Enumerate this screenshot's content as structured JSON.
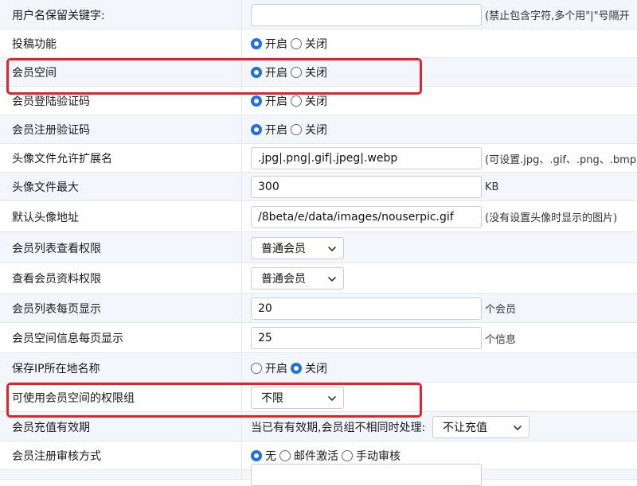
{
  "rows": [
    {
      "label": "用户名保留关键字:",
      "value": "",
      "hint": "(禁止包含字符,多个用\"|\"号隔开"
    },
    {
      "label": "投稿功能",
      "options": [
        "开启",
        "关闭"
      ],
      "selected": "开启"
    },
    {
      "label": "会员空间",
      "options": [
        "开启",
        "关闭"
      ],
      "selected": "开启"
    },
    {
      "label": "会员登陆验证码",
      "options": [
        "开启",
        "关闭"
      ],
      "selected": "开启"
    },
    {
      "label": "会员注册验证码",
      "options": [
        "开启",
        "关闭"
      ],
      "selected": "开启"
    },
    {
      "label": "头像文件允许扩展名",
      "value": ".jpg|.png|.gif|.jpeg|.webp",
      "hint": "(可设置.jpg、.gif、.png、.bmp"
    },
    {
      "label": "头像文件最大",
      "value": "300",
      "hint": "KB"
    },
    {
      "label": "默认头像地址",
      "value": "/8beta/e/data/images/nouserpic.gif",
      "hint": "(没有设置头像时显示的图片)"
    },
    {
      "label": "会员列表查看权限",
      "select": "普通会员"
    },
    {
      "label": "查看会员资料权限",
      "select": "普通会员"
    },
    {
      "label": "会员列表每页显示",
      "value": "20",
      "hint": "个会员"
    },
    {
      "label": "会员空间信息每页显示",
      "value": "25",
      "hint": "个信息"
    },
    {
      "label": "保存IP所在地名称",
      "options": [
        "开启",
        "关闭"
      ],
      "selected": "关闭"
    },
    {
      "label": "可使用会员空间的权限组",
      "select": "不限"
    },
    {
      "label": "会员充值有效期",
      "text": "当已有有效期,会员组不相同时处理:",
      "select": "不让充值"
    },
    {
      "label": "会员注册审核方式",
      "options": [
        "无",
        "邮件激活",
        "手动审核"
      ],
      "selected": "无"
    },
    {
      "label": "",
      "value": ""
    }
  ],
  "colors": {
    "accent": "#1f6fe5",
    "highlight": "#e3232b",
    "stripe": "#f3f7fb"
  }
}
